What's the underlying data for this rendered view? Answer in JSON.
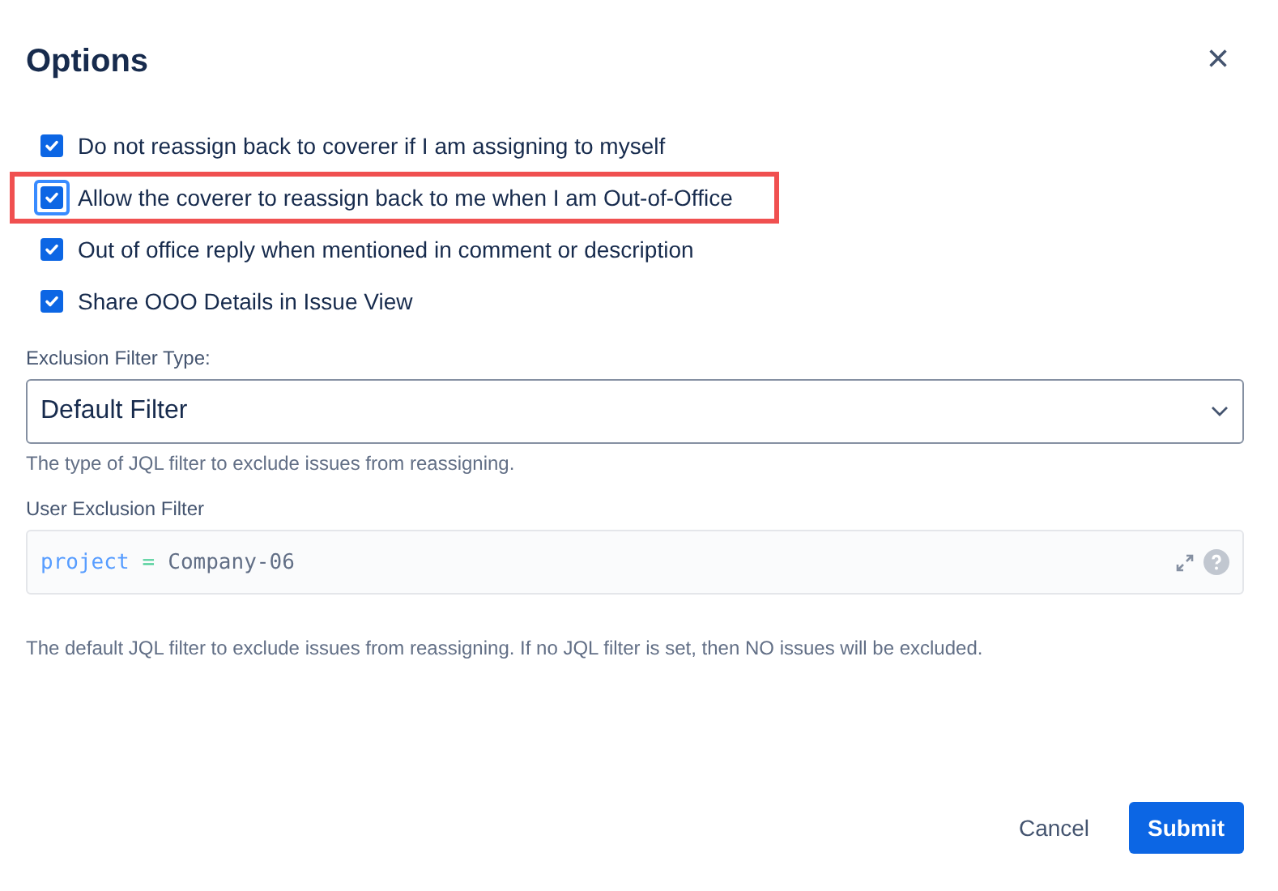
{
  "dialog": {
    "title": "Options",
    "close_icon": "×"
  },
  "options": [
    {
      "label": "Do not reassign back to coverer if I am assigning to myself",
      "checked": true,
      "focused": false,
      "highlighted": false
    },
    {
      "label": "Allow the coverer to reassign back to me when I am Out-of-Office",
      "checked": true,
      "focused": true,
      "highlighted": true
    },
    {
      "label": "Out of office reply when mentioned in comment or description",
      "checked": true,
      "focused": false,
      "highlighted": false
    },
    {
      "label": "Share OOO Details in Issue View",
      "checked": true,
      "focused": false,
      "highlighted": false
    }
  ],
  "exclusion_filter_type": {
    "label": "Exclusion Filter Type:",
    "value": "Default Filter",
    "help": "The type of JQL filter to exclude issues from reassigning."
  },
  "user_exclusion_filter": {
    "label": "User Exclusion Filter",
    "tokens": [
      {
        "kind": "keyword",
        "text": "project"
      },
      {
        "kind": "operator",
        "text": "="
      },
      {
        "kind": "value",
        "text": "Company-06"
      }
    ],
    "help": "The default JQL filter to exclude issues from reassigning. If no JQL filter is set, then NO issues will be excluded."
  },
  "buttons": [
    {
      "label": "Cancel",
      "kind": "subtle"
    },
    {
      "label": "Submit",
      "kind": "primary"
    }
  ]
}
